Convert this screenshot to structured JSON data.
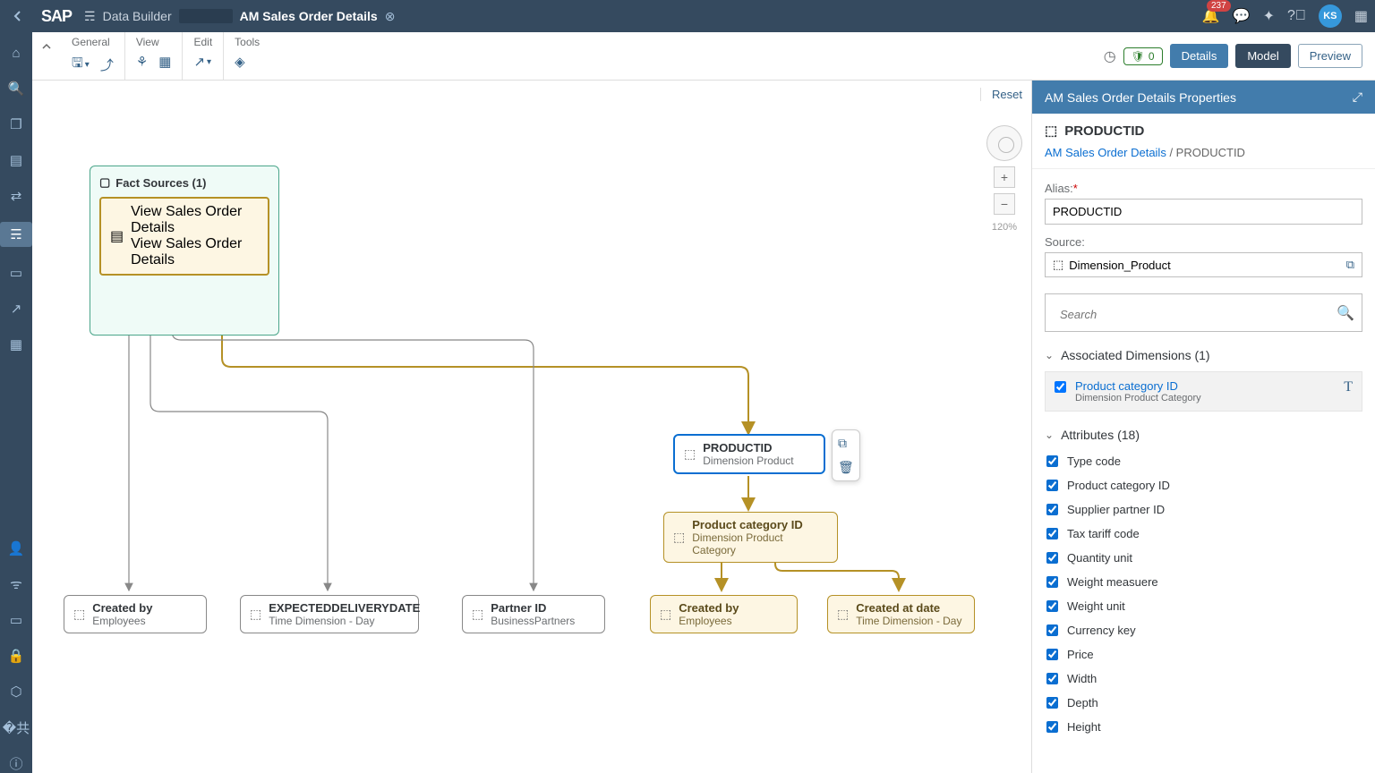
{
  "topbar": {
    "logo_text": "SAP",
    "breadcrumb_app": "Data Builder",
    "breadcrumb_title": "AM Sales Order Details",
    "notification_count": "237",
    "avatar_initials": "KS"
  },
  "ribbon": {
    "groups": {
      "general": "General",
      "view": "View",
      "edit": "Edit",
      "tools": "Tools"
    },
    "status_count": "0",
    "tabs": {
      "details": "Details",
      "model": "Model",
      "preview": "Preview"
    }
  },
  "canvas": {
    "reset": "Reset",
    "zoom": "120%",
    "fact_container": {
      "title": "Fact Sources (1)",
      "node_title": "View Sales Order Details",
      "node_sub": "View Sales Order Details"
    },
    "nodes": {
      "productid": {
        "title": "PRODUCTID",
        "sub": "Dimension Product"
      },
      "prodcat": {
        "title": "Product category ID",
        "sub": "Dimension Product Category"
      },
      "createdby": {
        "title": "Created by",
        "sub": "Employees"
      },
      "expected": {
        "title": "EXPECTEDDELIVERYDATE",
        "sub": "Time Dimension - Day"
      },
      "partner": {
        "title": "Partner ID",
        "sub": "BusinessPartners"
      },
      "createdby2": {
        "title": "Created by",
        "sub": "Employees"
      },
      "createdat": {
        "title": "Created at date",
        "sub": "Time Dimension - Day"
      }
    }
  },
  "panel": {
    "header": "AM Sales Order Details Properties",
    "title": "PRODUCTID",
    "crumb_link": "AM Sales Order Details",
    "crumb_sep": " / ",
    "crumb_current": "PRODUCTID",
    "alias_label": "Alias:",
    "alias_value": "PRODUCTID",
    "source_label": "Source:",
    "source_value": "Dimension_Product",
    "search_placeholder": "Search",
    "assoc_title": "Associated Dimensions (1)",
    "assoc_item_title": "Product category ID",
    "assoc_item_sub": "Dimension Product Category",
    "attr_title": "Attributes (18)",
    "attributes": [
      "Type code",
      "Product category ID",
      "Supplier partner ID",
      "Tax tariff code",
      "Quantity unit",
      "Weight measuere",
      "Weight unit",
      "Currency key",
      "Price",
      "Width",
      "Depth",
      "Height"
    ]
  }
}
